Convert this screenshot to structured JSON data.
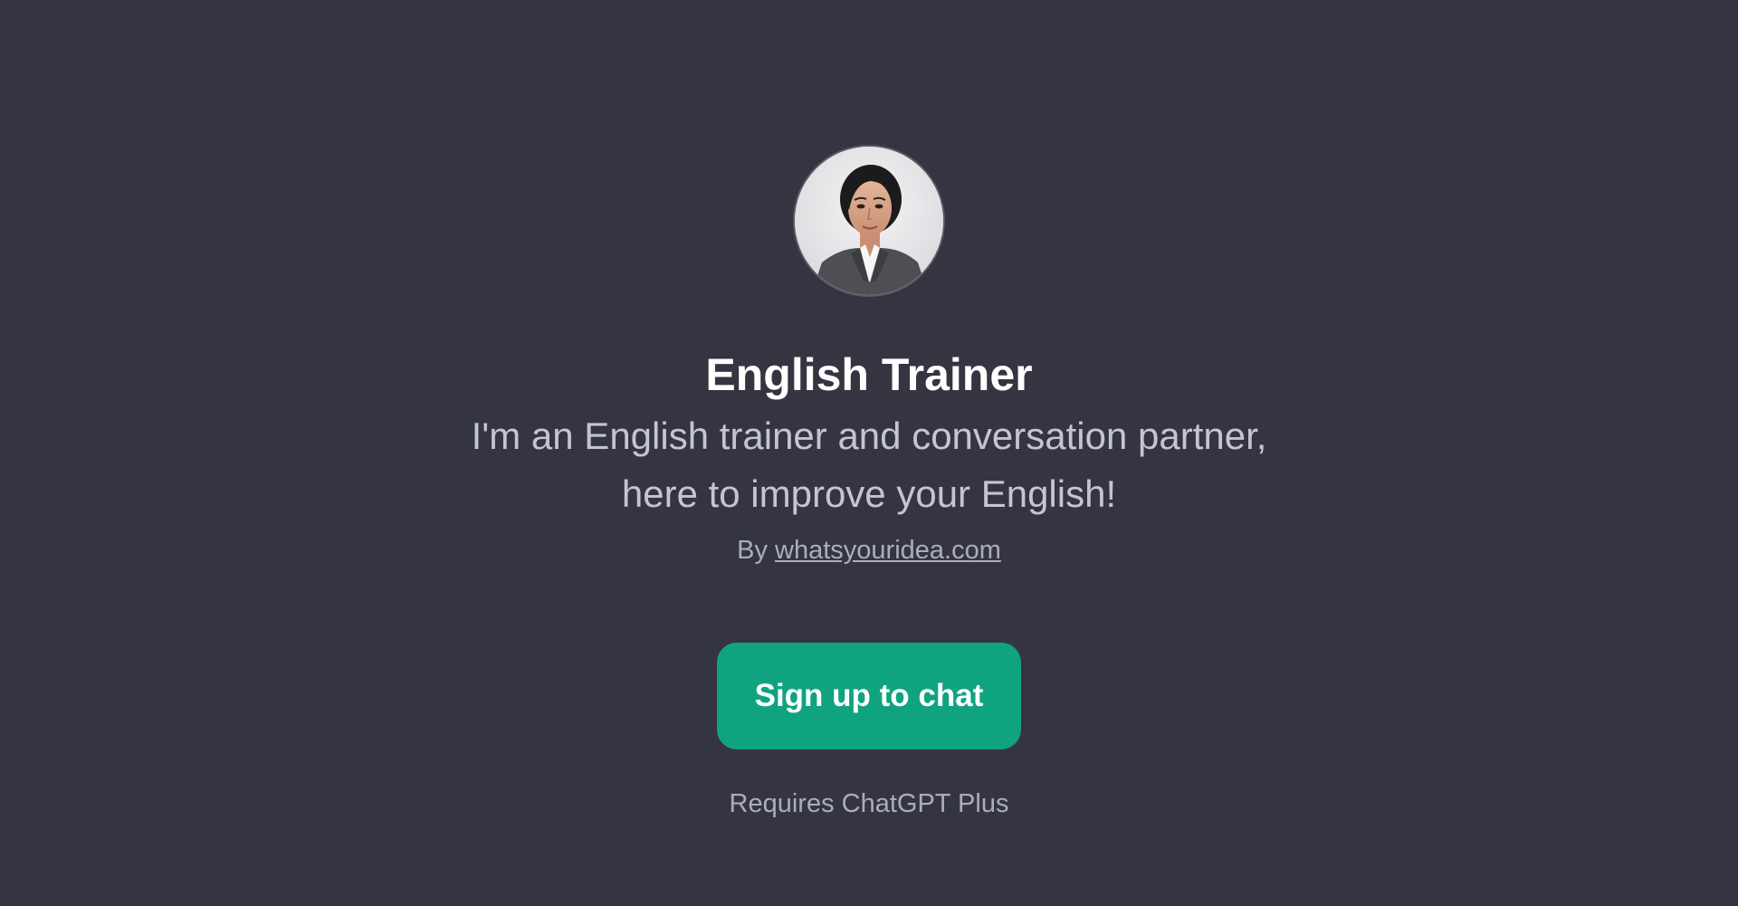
{
  "gpt": {
    "name": "English Trainer",
    "description_line1": "I'm an English trainer and conversation partner,",
    "description_line2": "here to improve your English!",
    "byline_prefix": "By",
    "author": "whatsyouridea.com"
  },
  "actions": {
    "signup_label": "Sign up to chat"
  },
  "footer": {
    "requirement": "Requires ChatGPT Plus"
  },
  "colors": {
    "background": "#343541",
    "accent": "#10a37f",
    "title": "#ffffff",
    "description": "#c5c5d2",
    "muted": "#acacbe"
  },
  "icons": {
    "avatar": "trainer-avatar-icon"
  }
}
